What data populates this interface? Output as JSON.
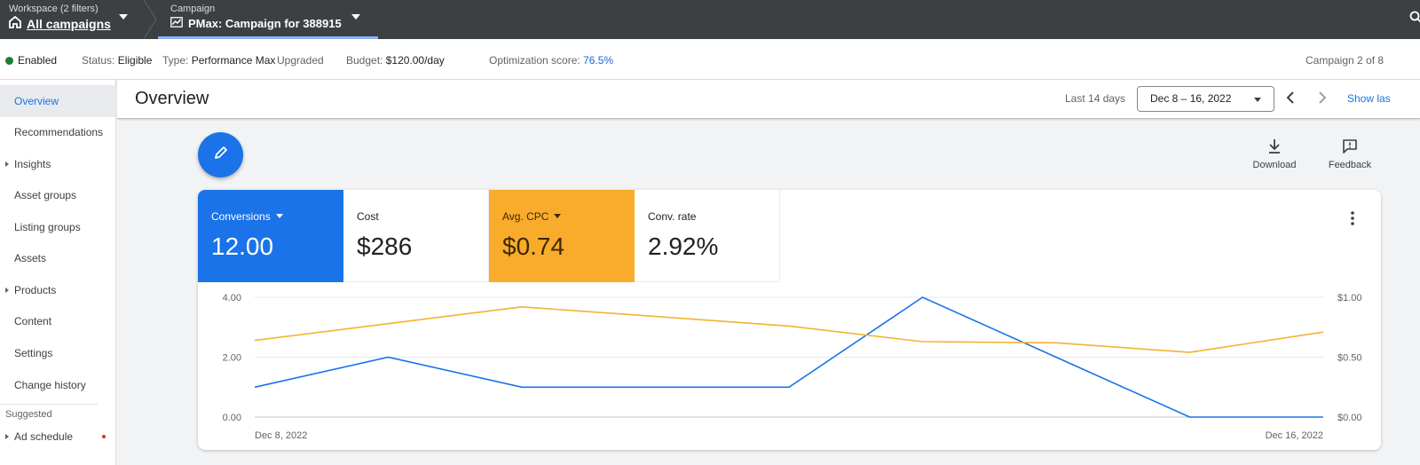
{
  "topbar": {
    "workspace_sub": "Workspace (2 filters)",
    "workspace_main": "All campaigns",
    "campaign_sub": "Campaign",
    "campaign_main": "PMax: Campaign for 388915"
  },
  "status": {
    "enabled": "Enabled",
    "status_label": "Status:",
    "status_value": "Eligible",
    "type_label": "Type:",
    "type_value": "Performance Max",
    "upgraded": "Upgraded",
    "budget_label": "Budget:",
    "budget_value": "$120.00/day",
    "opt_label": "Optimization score:",
    "opt_value": "76.5%",
    "campaign_count": "Campaign 2 of 8",
    "colors": {
      "enabled_dot": "#188038",
      "score": "#1967d2"
    }
  },
  "sidebar": {
    "items": [
      {
        "label": "Overview",
        "active": true,
        "caret": false
      },
      {
        "label": "Recommendations",
        "active": false,
        "caret": false
      },
      {
        "label": "Insights",
        "active": false,
        "caret": true
      },
      {
        "label": "Asset groups",
        "active": false,
        "caret": false
      },
      {
        "label": "Listing groups",
        "active": false,
        "caret": false
      },
      {
        "label": "Assets",
        "active": false,
        "caret": false
      },
      {
        "label": "Products",
        "active": false,
        "caret": true
      },
      {
        "label": "Content",
        "active": false,
        "caret": false
      },
      {
        "label": "Settings",
        "active": false,
        "caret": false
      },
      {
        "label": "Change history",
        "active": false,
        "caret": false
      }
    ],
    "suggested_label": "Suggested",
    "suggested_items": [
      {
        "label": "Ad schedule",
        "caret": true,
        "badge": true
      }
    ]
  },
  "header": {
    "title": "Overview",
    "last_days": "Last 14 days",
    "date_range": "Dec 8 – 16, 2022",
    "show_last": "Show las"
  },
  "actions": {
    "download": "Download",
    "feedback": "Feedback"
  },
  "metrics": [
    {
      "label": "Conversions",
      "value": "12.00",
      "style": "blue",
      "dropdown": true
    },
    {
      "label": "Cost",
      "value": "$286",
      "style": "white",
      "dropdown": false
    },
    {
      "label": "Avg. CPC",
      "value": "$0.74",
      "style": "orange",
      "dropdown": true
    },
    {
      "label": "Conv. rate",
      "value": "2.92%",
      "style": "white",
      "dropdown": false
    }
  ],
  "chart_data": {
    "type": "line",
    "x_labels": [
      "Dec 8, 2022",
      "Dec 16, 2022"
    ],
    "x": [
      "Dec 8",
      "Dec 9",
      "Dec 10",
      "Dec 11",
      "Dec 12",
      "Dec 13",
      "Dec 14",
      "Dec 15",
      "Dec 16"
    ],
    "left_axis": {
      "ticks": [
        "4.00",
        "2.00",
        "0.00"
      ],
      "ylim": [
        0,
        4
      ]
    },
    "right_axis": {
      "ticks": [
        "$1.00",
        "$0.50",
        "$0.00"
      ],
      "ylim": [
        0,
        1
      ]
    },
    "grid": true,
    "series": [
      {
        "name": "Conversions",
        "axis": "left",
        "color": "#1a73e8",
        "values": [
          1,
          2,
          1,
          1,
          1,
          4,
          2,
          0,
          0
        ]
      },
      {
        "name": "Avg. CPC",
        "axis": "right",
        "color": "#f0b432",
        "values": [
          0.64,
          0.78,
          0.92,
          0.84,
          0.76,
          0.63,
          0.62,
          0.54,
          0.71
        ]
      }
    ]
  }
}
